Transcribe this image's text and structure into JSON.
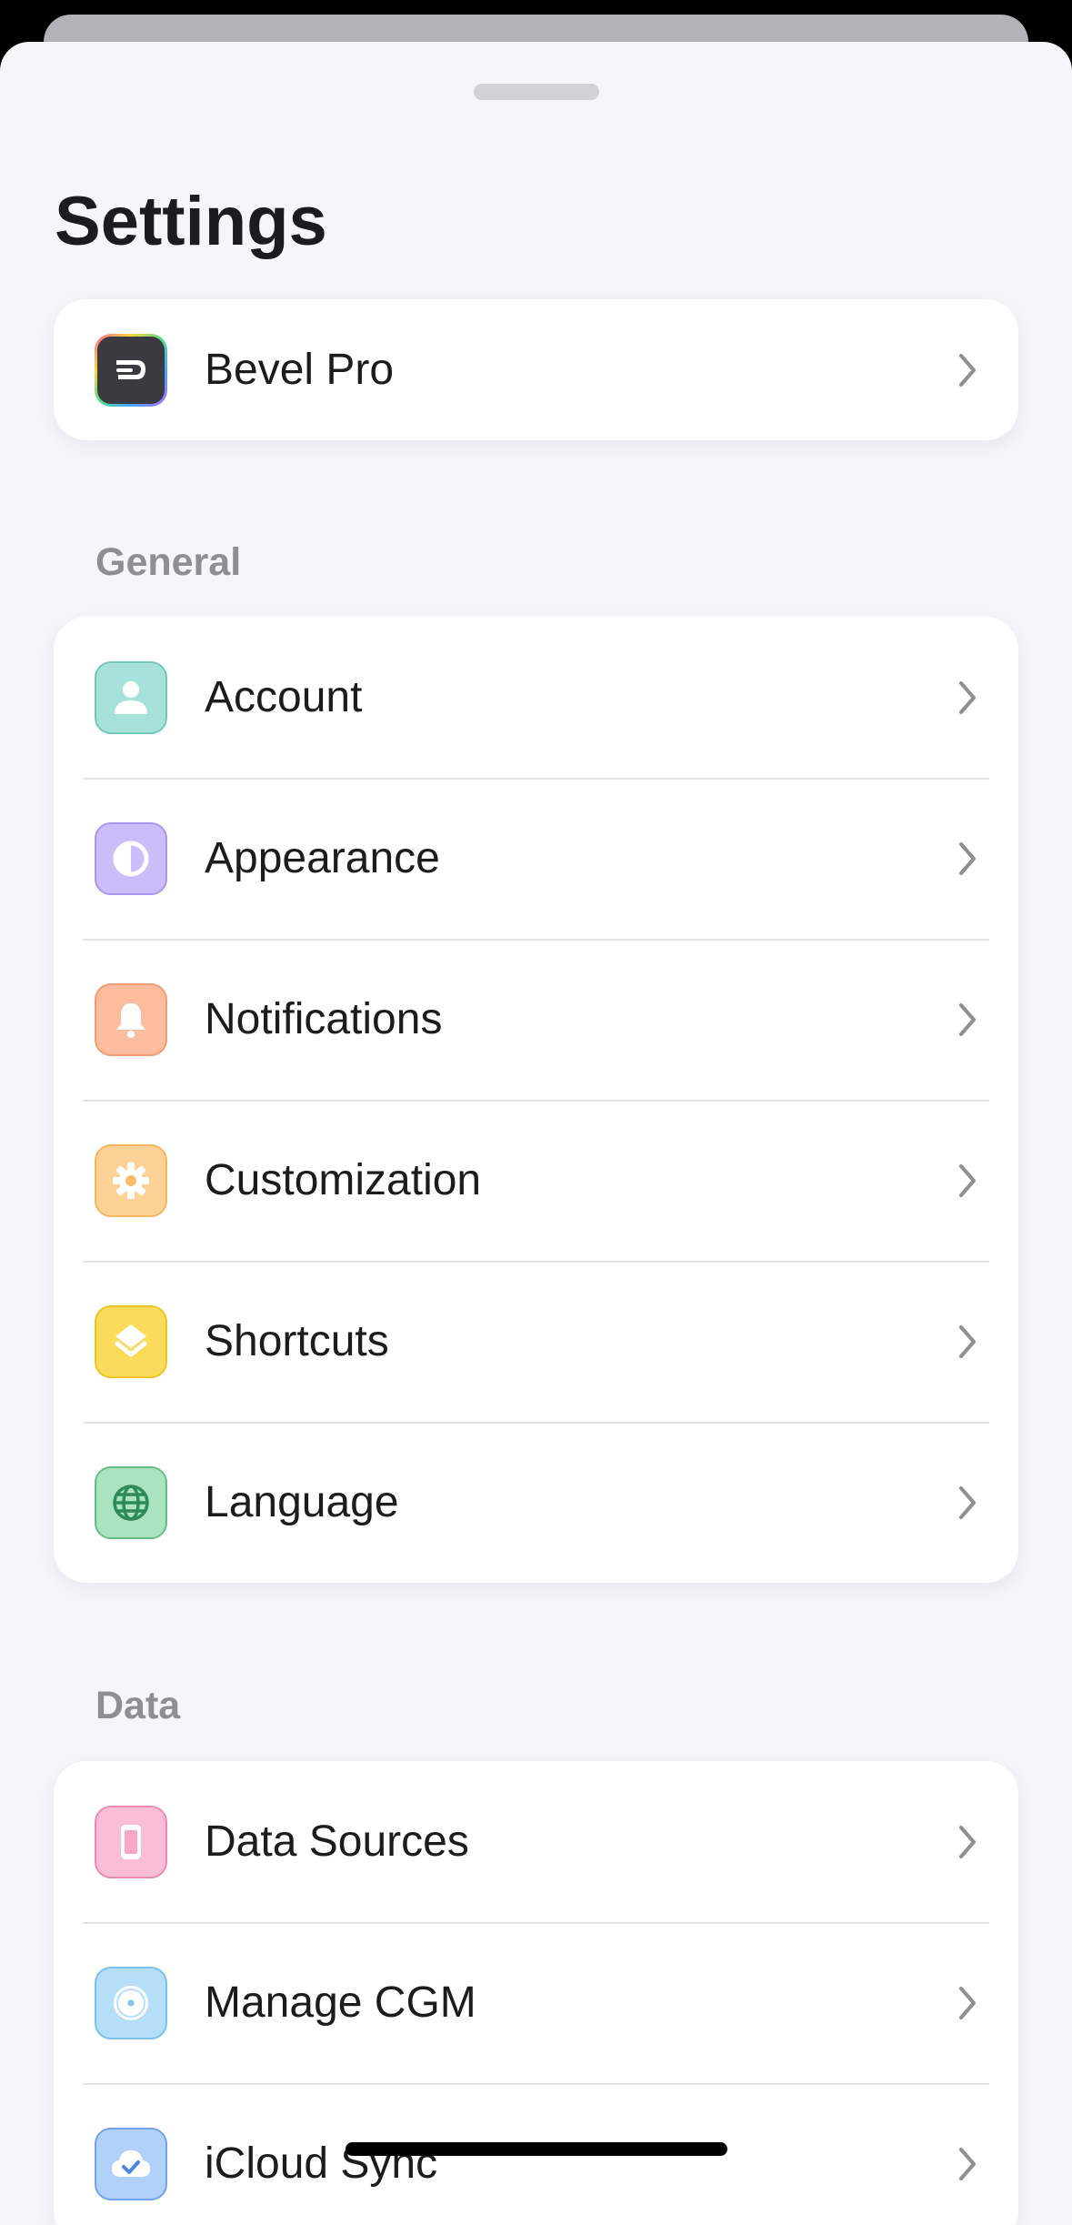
{
  "header": {
    "title": "Settings"
  },
  "pro": {
    "label": "Bevel Pro",
    "icon": "bevel-logo-icon"
  },
  "general": {
    "heading": "General",
    "items": [
      {
        "label": "Account",
        "icon": "person-icon",
        "color": "#7fd3c6"
      },
      {
        "label": "Appearance",
        "icon": "half-circle-icon",
        "color": "#b9a6f5"
      },
      {
        "label": "Notifications",
        "icon": "bell-icon",
        "color": "#f9a882"
      },
      {
        "label": "Customization",
        "icon": "gear-icon",
        "color": "#fbc374"
      },
      {
        "label": "Shortcuts",
        "icon": "layers-icon",
        "color": "#f9d443"
      },
      {
        "label": "Language",
        "icon": "globe-icon",
        "color": "#8ad7a8"
      }
    ]
  },
  "data": {
    "heading": "Data",
    "items": [
      {
        "label": "Data Sources",
        "icon": "phone-icon",
        "color": "#f7a6c7"
      },
      {
        "label": "Manage CGM",
        "icon": "sensor-icon",
        "color": "#94d0f6"
      },
      {
        "label": "iCloud Sync",
        "icon": "cloud-check-icon",
        "color": "#8cbaf6"
      }
    ]
  }
}
